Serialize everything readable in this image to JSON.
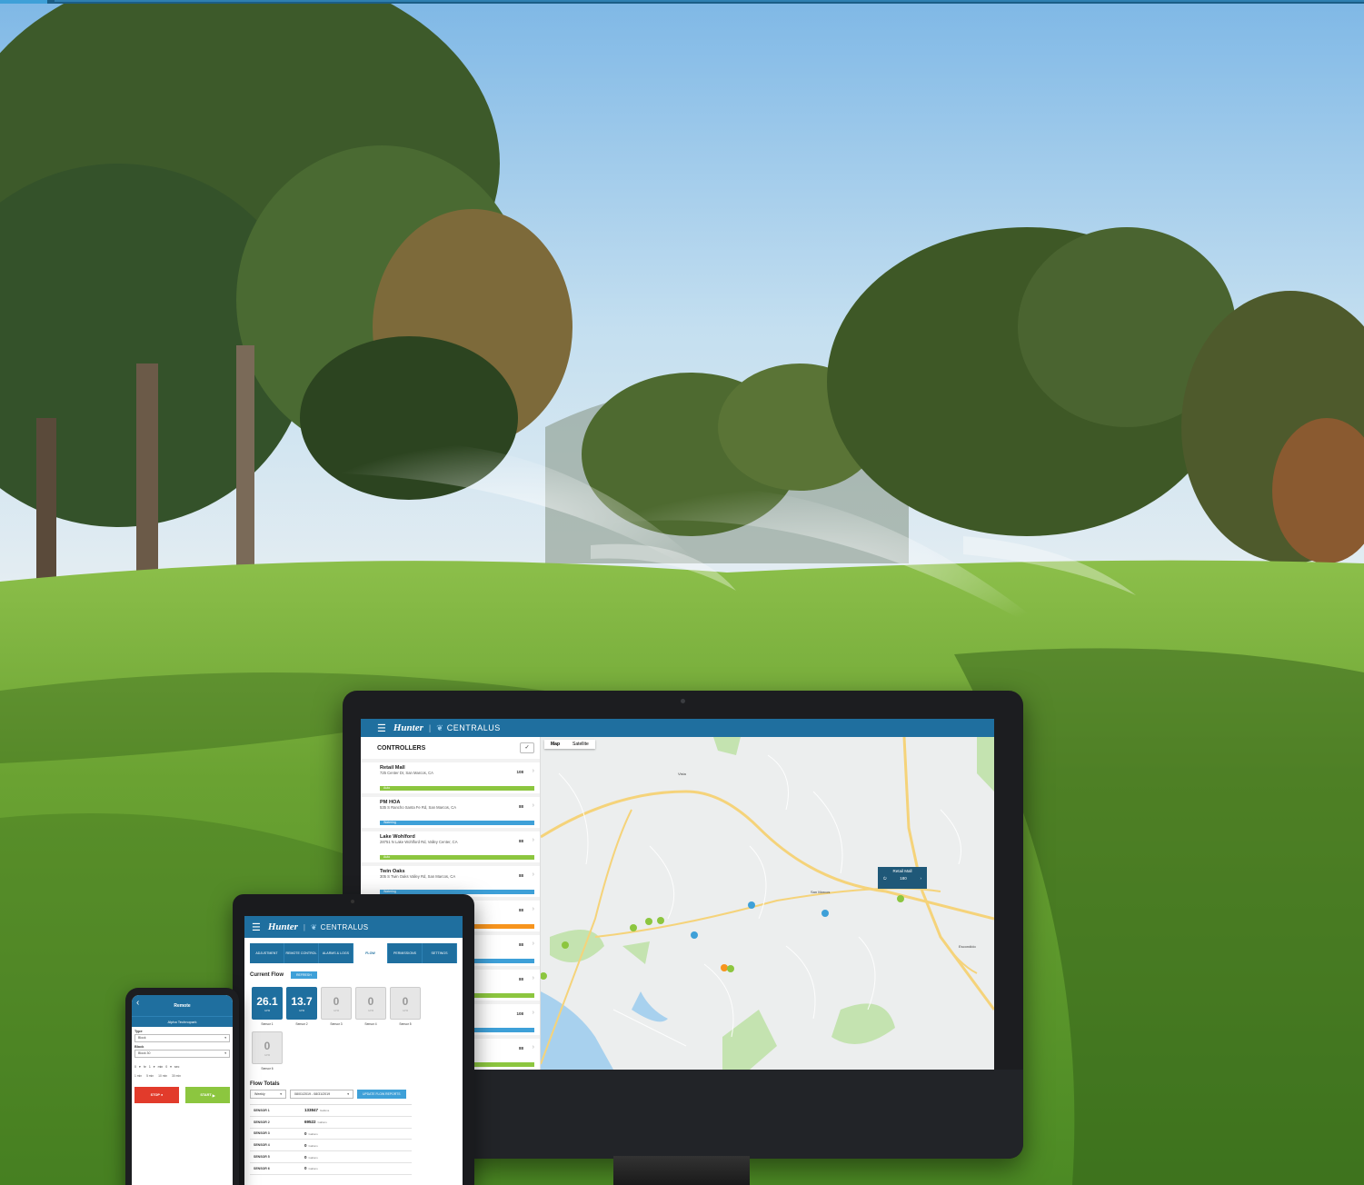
{
  "background": {
    "description_colors": {
      "sky": "#a9d2ee",
      "grass": "#5a9a2e"
    }
  },
  "colors": {
    "brand_blue": "#1f6f9f",
    "accent_blue": "#3ea0d8",
    "auto_green": "#8cc63f",
    "orange": "#f7941d",
    "stop_red": "#e23b2b"
  },
  "desktop": {
    "brand": "Hunter",
    "product": "CENTRALUS",
    "controllers_title": "CONTROLLERS",
    "controllers": [
      {
        "name": "Retail Mall",
        "address": "725 Center Dr, San Marcos, CA",
        "value": "108",
        "status": "Auto",
        "status_color": "#8cc63f"
      },
      {
        "name": "PM HOA",
        "address": "535 S Rancho Santa Fe Rd, San Marcos, CA",
        "value": "88",
        "status": "Watering",
        "status_color": "#3ea0d8"
      },
      {
        "name": "Lake Wohlford",
        "address": "28751 N Lake Wohlford Rd, Valley Center, CA",
        "value": "88",
        "status": "Auto",
        "status_color": "#8cc63f"
      },
      {
        "name": "Twin Oaks",
        "address": "305 S Twin Oaks Valley Rd, San Marcos, CA",
        "value": "88",
        "status": "Watering",
        "status_color": "#3ea0d8"
      },
      {
        "name": "",
        "address": "CA",
        "value": "88",
        "status": "",
        "status_color": "#f7941d"
      },
      {
        "name": "",
        "address": "CA",
        "value": "88",
        "status": "",
        "status_color": "#3ea0d8"
      },
      {
        "name": "",
        "address": "",
        "value": "88",
        "status": "",
        "status_color": "#8cc63f"
      },
      {
        "name": "",
        "address": "",
        "value": "108",
        "status": "",
        "status_color": "#3ea0d8"
      },
      {
        "name": "",
        "address": "",
        "value": "88",
        "status": "",
        "status_color": "#8cc63f"
      }
    ],
    "map_tabs": [
      "Map",
      "Satellite"
    ],
    "map_labels": [
      "Vista",
      "San Marcos",
      "Escondido"
    ],
    "infobox": {
      "title": "Retail Mall",
      "value": "180"
    }
  },
  "tablet": {
    "brand": "Hunter",
    "product": "CENTRALUS",
    "tabs": [
      "ADJUSTMENT",
      "REMOTE CONTROL",
      "ALARMS & LOGS",
      "FLOW",
      "PERMISSIONS",
      "SETTINGS"
    ],
    "active_tab": "FLOW",
    "current_flow_title": "Current Flow",
    "current_flow_chip": "REFRESH",
    "unit": "GPM",
    "sensors": [
      {
        "value": "26.1",
        "label": "Sensor 1"
      },
      {
        "value": "13.7",
        "label": "Sensor 2"
      },
      {
        "value": "0",
        "label": "Sensor 3"
      },
      {
        "value": "0",
        "label": "Sensor 4"
      },
      {
        "value": "0",
        "label": "Sensor 5"
      },
      {
        "value": "0",
        "label": "Sensor 6"
      }
    ],
    "flow_totals_title": "Flow Totals",
    "period": "Weekly",
    "date_range": "08/01/2019 - 08/31/2019",
    "update_button": "UPDATE FLOW REPORTS",
    "totals": [
      {
        "sensor": "SENSOR 1",
        "value": "133847",
        "unit": "Gallons"
      },
      {
        "sensor": "SENSOR 2",
        "value": "69522",
        "unit": "Gallons"
      },
      {
        "sensor": "SENSOR 3",
        "value": "0",
        "unit": "Gallons"
      },
      {
        "sensor": "SENSOR 4",
        "value": "0",
        "unit": "Gallons"
      },
      {
        "sensor": "SENSOR 5",
        "value": "0",
        "unit": "Gallons"
      },
      {
        "sensor": "SENSOR 6",
        "value": "0",
        "unit": "Gallons"
      }
    ]
  },
  "phone": {
    "title": "Remote",
    "site": "Alpha Technopark",
    "type_label": "Type",
    "type_value": "Block",
    "block_label": "Block",
    "block_value": "Block 30",
    "duration": [
      "0",
      "hr",
      "1",
      "min",
      "0",
      "sec"
    ],
    "quick_buttons": [
      "1 min",
      "5 min",
      "10 min",
      "30 min"
    ],
    "stop_label": "STOP",
    "start_label": "START"
  }
}
